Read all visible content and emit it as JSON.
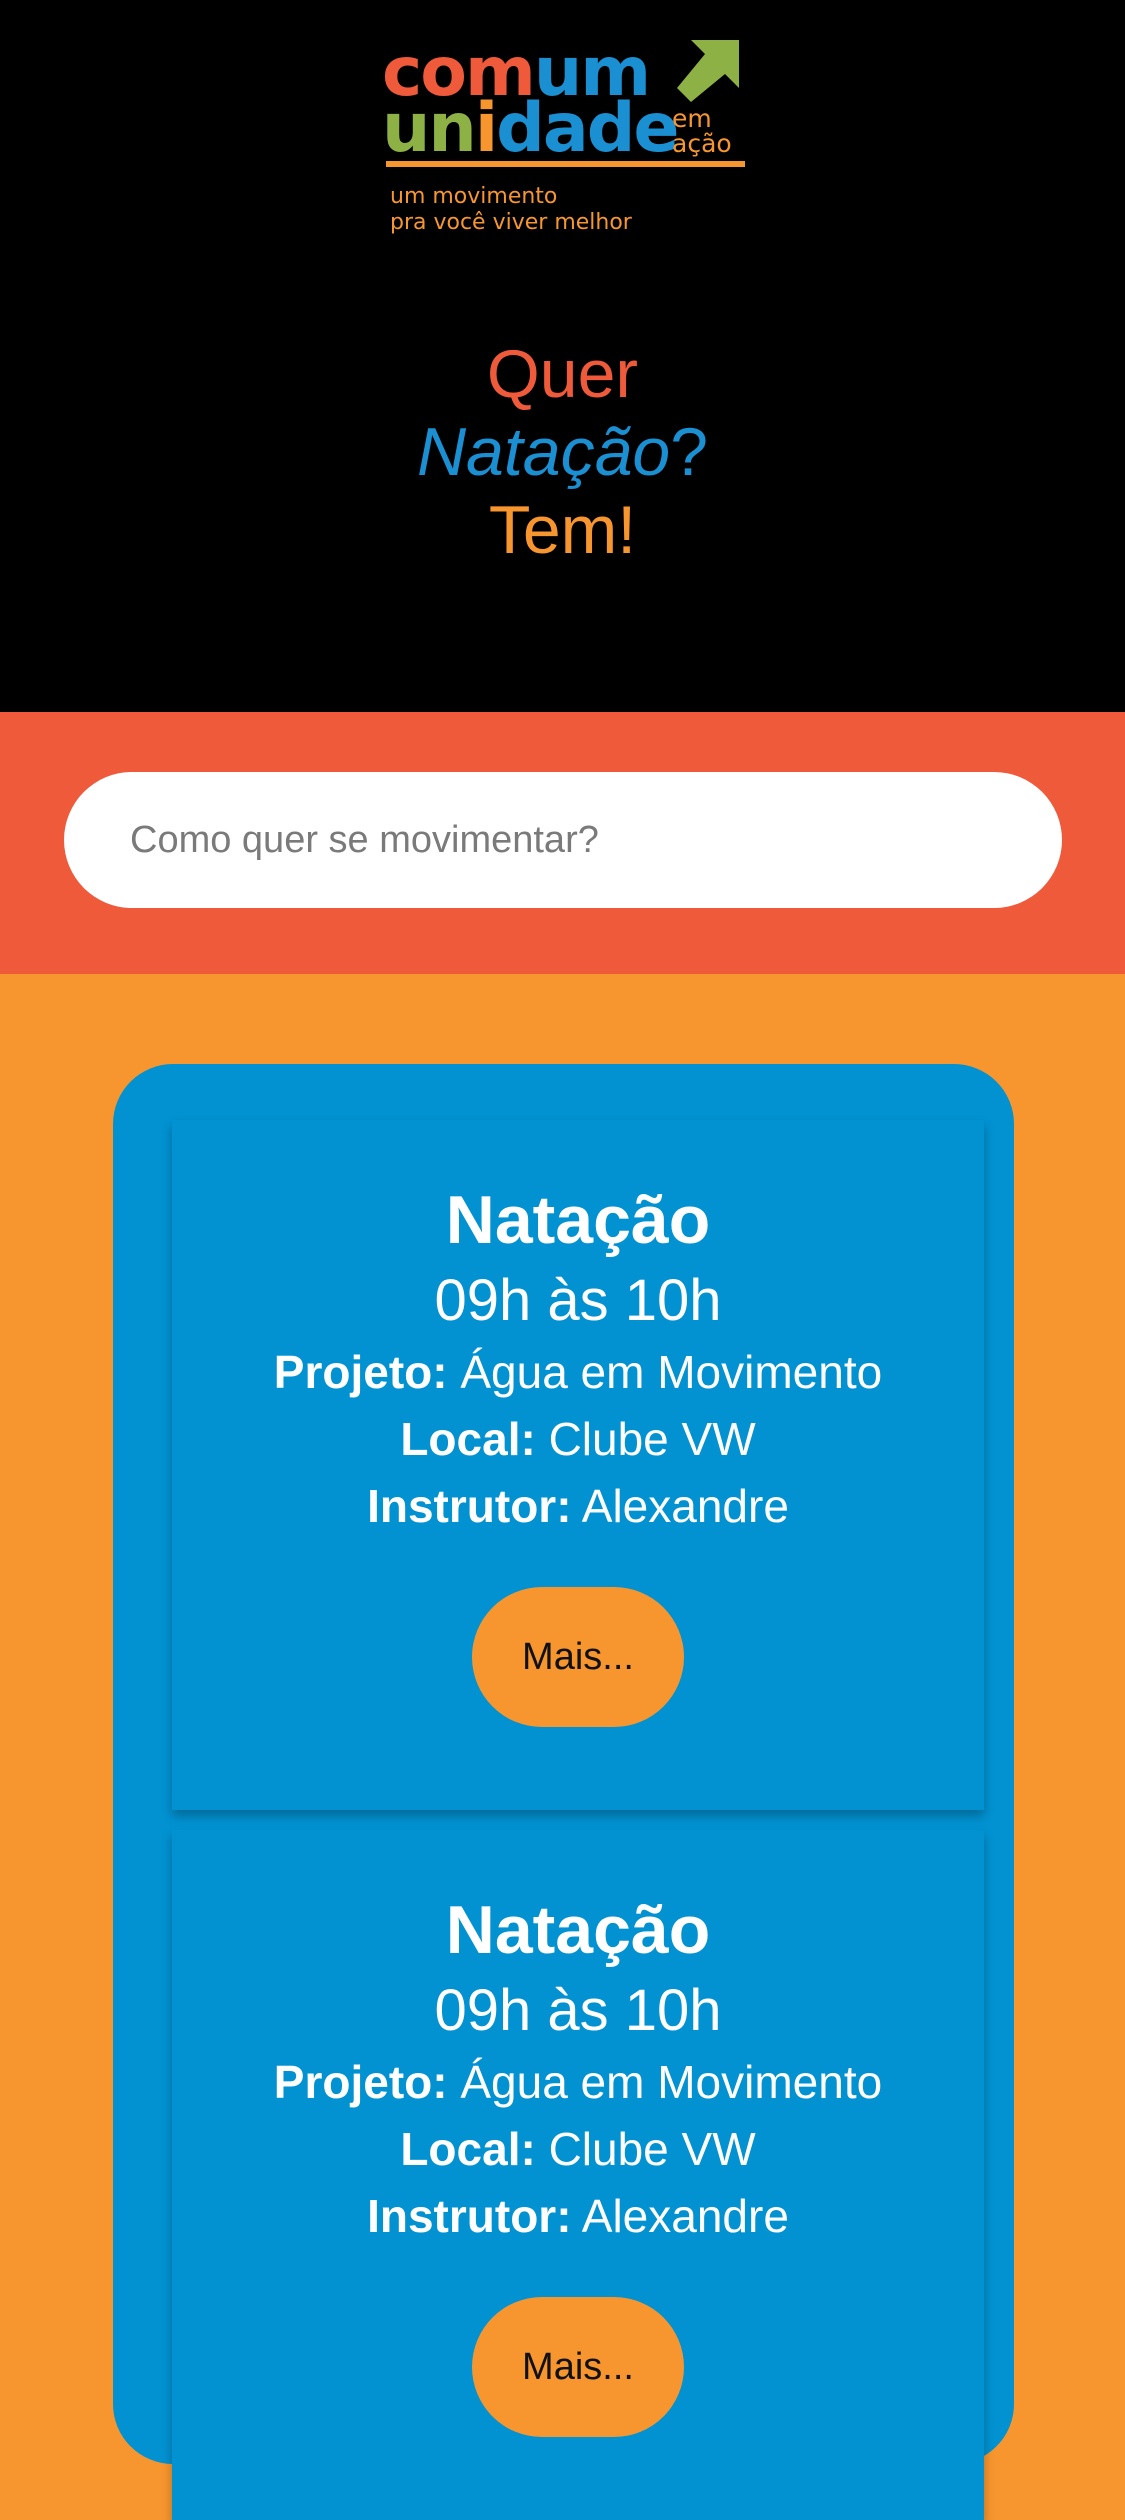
{
  "logo": {
    "line1": [
      "com",
      "um"
    ],
    "line2": [
      "un",
      "i",
      "dade"
    ],
    "em": "em",
    "acao": "ação",
    "tagline1": "um movimento",
    "tagline2": "pra você viver melhor",
    "arrow_icon": "arrow-up-right-icon"
  },
  "hero": {
    "line1": "Quer",
    "activity": "Natação",
    "question": "?",
    "line3": "Tem!"
  },
  "search": {
    "placeholder": "Como quer se movimentar?",
    "value": ""
  },
  "cards": [
    {
      "title": "Natação",
      "time": "09h às 10h",
      "projeto_label": "Projeto:",
      "projeto": "Água em Movimento",
      "local_label": "Local:",
      "local": "Clube VW",
      "instrutor_label": "Instrutor:",
      "instrutor": "Alexandre",
      "button": "Mais..."
    },
    {
      "title": "Natação",
      "time": "09h às 10h",
      "projeto_label": "Projeto:",
      "projeto": "Água em Movimento",
      "local_label": "Local:",
      "local": "Clube VW",
      "instrutor_label": "Instrutor:",
      "instrutor": "Alexandre",
      "button": "Mais..."
    }
  ],
  "colors": {
    "header_bg": "#000000",
    "red": "#ef5a3a",
    "orange": "#f7962f",
    "blue": "#0292d2",
    "green": "#8db144"
  }
}
